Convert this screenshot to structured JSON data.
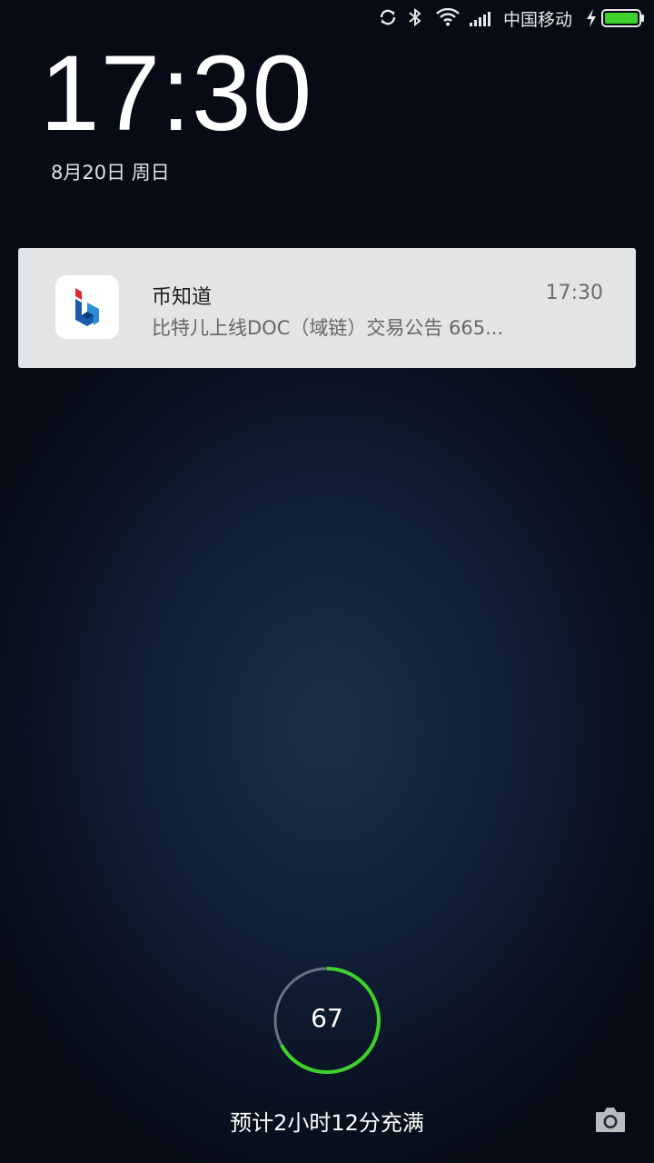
{
  "status_bar": {
    "carrier": "中国移动",
    "icons": [
      "sync-icon",
      "bluetooth-icon",
      "wifi-icon",
      "signal-icon",
      "charging-bolt-icon",
      "battery-icon"
    ],
    "battery_color": "#3fd12b"
  },
  "lockscreen": {
    "time": "17:30",
    "date": "8月20日 周日"
  },
  "notification": {
    "app_name": "币知道",
    "time": "17:30",
    "text": "比特儿上线DOC（域链）交易公告 665..."
  },
  "charging": {
    "percent": "67",
    "level": 0.67,
    "estimate": "预计2小时12分充满",
    "ring_color": "#3fd12b"
  },
  "camera_shortcut": {
    "icon": "camera-icon"
  }
}
